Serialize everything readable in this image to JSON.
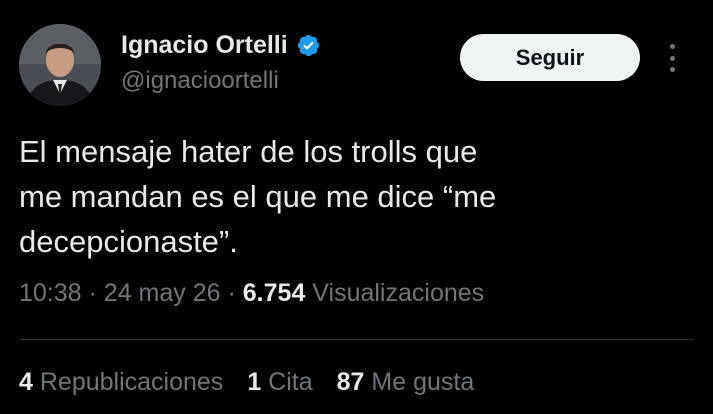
{
  "colors": {
    "background": "#000000",
    "text_primary": "#e7e9ea",
    "text_secondary": "#71767b",
    "verified_badge": "#1d9bf0",
    "follow_button_bg": "#eff3f4",
    "divider": "#2f3336"
  },
  "author": {
    "name": "Ignacio Ortelli",
    "handle": "@ignacioortelli",
    "verified_icon": "verified-badge-icon",
    "avatar_icon": "profile-photo"
  },
  "follow_button": {
    "label": "Seguir"
  },
  "more_menu": {
    "icon": "more-vertical-icon"
  },
  "tweet": {
    "lines": [
      "El mensaje hater de los trolls que",
      "me mandan es el que me dice “me",
      "decepcionaste”."
    ]
  },
  "meta": {
    "time": "10:38",
    "separator": "·",
    "date": "24 may 26",
    "views_count": "6.754",
    "views_label": "Visualizaciones"
  },
  "stats": {
    "reposts_count": "4",
    "reposts_label": "Republicaciones",
    "quotes_count": "1",
    "quotes_label": "Cita",
    "likes_count": "87",
    "likes_label": "Me gusta"
  }
}
